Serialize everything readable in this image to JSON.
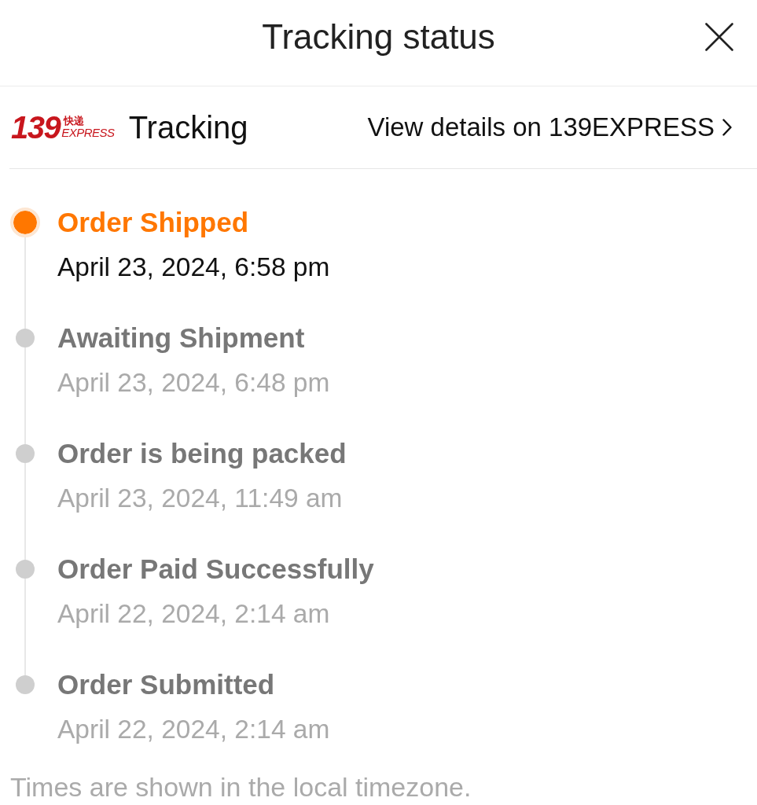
{
  "header": {
    "title": "Tracking status"
  },
  "carrier": {
    "logo": {
      "number": "139",
      "chinese": "快递",
      "word": "EXPRESS"
    },
    "label": "Tracking",
    "link": "View details on 139EXPRESS"
  },
  "events": [
    {
      "title": "Order Shipped",
      "time": "April 23, 2024, 6:58 pm",
      "current": true
    },
    {
      "title": "Awaiting Shipment",
      "time": "April 23, 2024, 6:48 pm",
      "current": false
    },
    {
      "title": "Order is being packed",
      "time": "April 23, 2024, 11:49 am",
      "current": false
    },
    {
      "title": "Order Paid Successfully",
      "time": "April 22, 2024, 2:14 am",
      "current": false
    },
    {
      "title": "Order Submitted",
      "time": "April 22, 2024, 2:14 am",
      "current": false
    }
  ],
  "footer": "Times are shown in the local timezone."
}
